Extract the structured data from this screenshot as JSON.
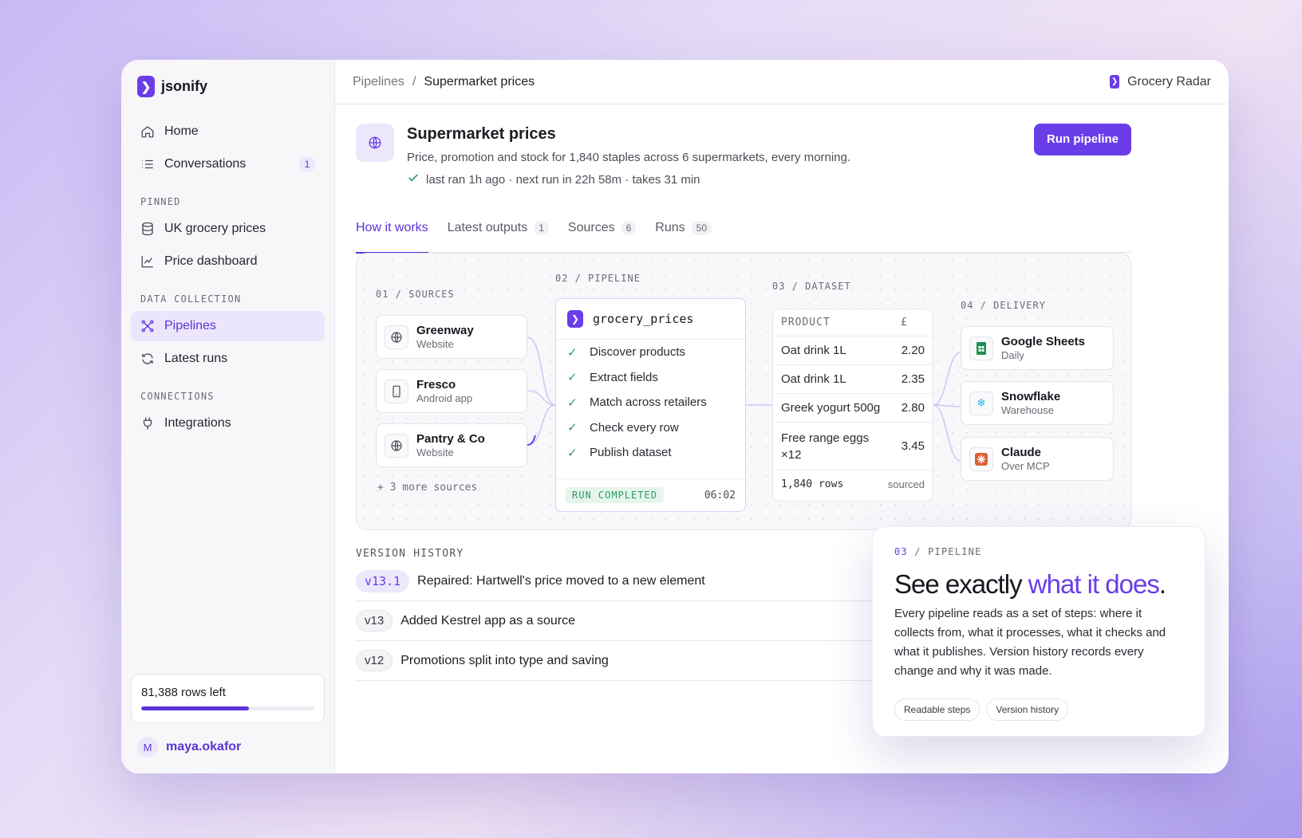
{
  "brand": {
    "logo_glyph": "❯",
    "name": "jsonify"
  },
  "sidebar": {
    "nav": [
      {
        "label": "Home",
        "icon": "home-icon"
      },
      {
        "label": "Conversations",
        "icon": "list-icon",
        "badge": "1"
      }
    ],
    "pinned_title": "PINNED",
    "pinned": [
      {
        "label": "UK grocery prices",
        "icon": "database-icon"
      },
      {
        "label": "Price dashboard",
        "icon": "chart-line-icon"
      }
    ],
    "data_collection_title": "DATA COLLECTION",
    "data_collection": [
      {
        "label": "Pipelines",
        "icon": "pipeline-icon",
        "active": true
      },
      {
        "label": "Latest runs",
        "icon": "refresh-icon"
      }
    ],
    "connections_title": "CONNECTIONS",
    "connections": [
      {
        "label": "Integrations",
        "icon": "plug-icon"
      }
    ],
    "quota": {
      "label": "81,388 rows left",
      "used_fraction": 0.62
    },
    "user": {
      "initial": "M",
      "name": "maya.okafor"
    }
  },
  "topbar": {
    "breadcrumb_root": "Pipelines",
    "breadcrumb_sep": "/",
    "breadcrumb_current": "Supermarket prices",
    "workspace": "Grocery Radar"
  },
  "pipeline": {
    "title": "Supermarket prices",
    "description": "Price, promotion and stock for 1,840 staples across 6 supermarkets, every morning.",
    "status": "last ran 1h ago · next run in 22h 58m · takes 31 min",
    "run_button": "Run pipeline"
  },
  "tabs": [
    {
      "label": "How it works",
      "active": true
    },
    {
      "label": "Latest outputs",
      "count": "1"
    },
    {
      "label": "Sources",
      "count": "6"
    },
    {
      "label": "Runs",
      "count": "50"
    }
  ],
  "flow": {
    "sources_label": "01 / SOURCES",
    "pipeline_label": "02 / PIPELINE",
    "dataset_label": "03 / DATASET",
    "delivery_label": "04 / DELIVERY",
    "sources": [
      {
        "name": "Greenway",
        "type": "Website",
        "icon": "globe-icon"
      },
      {
        "name": "Fresco",
        "type": "Android app",
        "icon": "phone-icon"
      },
      {
        "name": "Pantry & Co",
        "type": "Website",
        "icon": "globe-icon"
      }
    ],
    "more_sources": "+ 3 more sources",
    "pipeline_name": "grocery_prices",
    "steps": [
      "Discover products",
      "Extract fields",
      "Match across retailers",
      "Check every row",
      "Publish dataset"
    ],
    "run_status": "RUN COMPLETED",
    "run_duration": "06:02",
    "dataset": {
      "headers": [
        "PRODUCT",
        "£"
      ],
      "rows": [
        {
          "product": "Oat drink 1L",
          "price": "2.20"
        },
        {
          "product": "Oat drink 1L",
          "price": "2.35"
        },
        {
          "product": "Greek yogurt 500g",
          "price": "2.80"
        },
        {
          "product": "Free range eggs ×12",
          "price": "3.45"
        }
      ],
      "row_count": "1,840 rows",
      "row_suffix": "sourced"
    },
    "delivery": [
      {
        "name": "Google Sheets",
        "type": "Daily",
        "icon": "sheets-icon",
        "color": "#1e8e4e"
      },
      {
        "name": "Snowflake",
        "type": "Warehouse",
        "icon": "snowflake-icon",
        "color": "#29b5e8"
      },
      {
        "name": "Claude",
        "type": "Over MCP",
        "icon": "claude-icon",
        "color": "#d9643a"
      }
    ]
  },
  "version_history": {
    "title": "VERSION HISTORY",
    "entries": [
      {
        "version": "v13.1",
        "text": "Repaired: Hartwell's price moved to a new element",
        "current": true
      },
      {
        "version": "v13",
        "text": "Added Kestrel app as a source"
      },
      {
        "version": "v12",
        "text": "Promotions split into type and saving"
      }
    ]
  },
  "feature": {
    "label_num": "03",
    "label_text": " / PIPELINE",
    "title_start": "See exactly ",
    "title_highlight": "what it does",
    "title_end": ".",
    "body": "Every pipeline reads as a set of steps: where it collects from, what it processes, what it checks and what it publishes. Version history records every change and why it was made.",
    "chips": [
      "Readable steps",
      "Version history"
    ]
  },
  "colors": {
    "accent": "#6a3de8",
    "success": "#2e9a62"
  }
}
